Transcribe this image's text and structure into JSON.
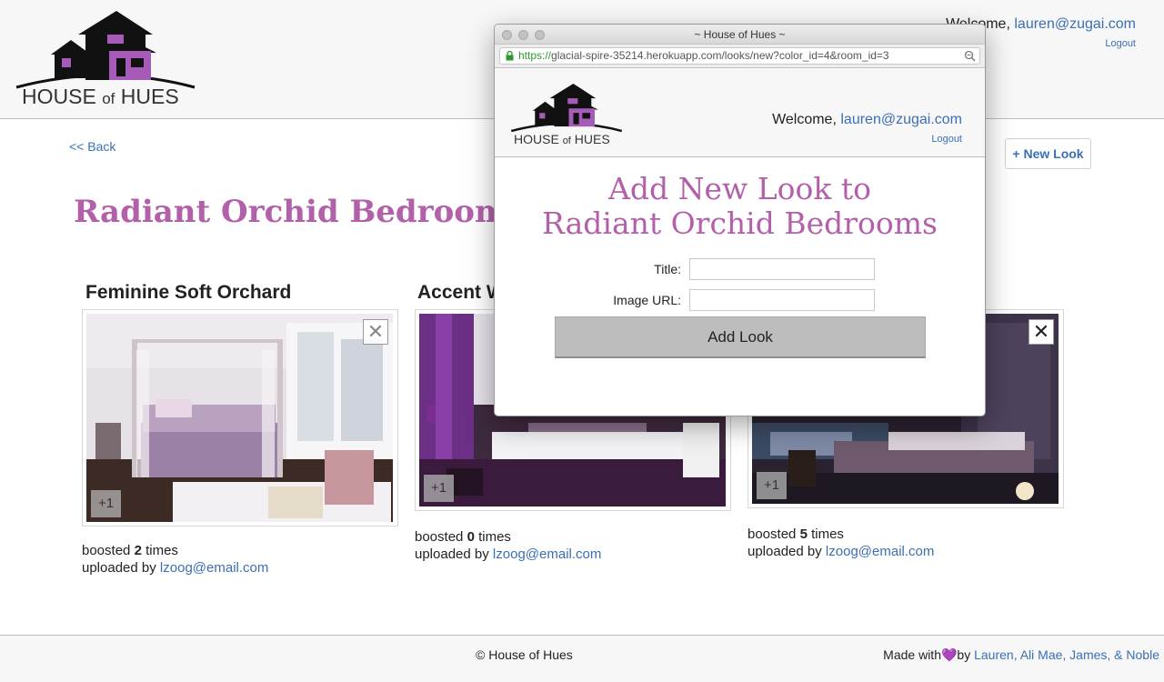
{
  "site": {
    "logo_main": "HOUSE",
    "logo_of": "of",
    "logo_end": "HUES",
    "welcome_prefix": "Welcome,",
    "user_email": "lauren@zugai.com",
    "logout_label": "Logout"
  },
  "page": {
    "back_label": "<< Back",
    "new_look_label": "+ New Look",
    "title": "Radiant Orchid Bedroom Lo"
  },
  "cards": [
    {
      "title": "Feminine Soft Orchard",
      "boost_label": "+1",
      "close_symbol": "✕",
      "boosted_prefix": "boosted",
      "boost_count": "2",
      "boosted_suffix": "times",
      "uploaded_prefix": "uploaded by",
      "uploader": "lzoog@email.com"
    },
    {
      "title": "Accent W",
      "boost_label": "+1",
      "boosted_prefix": "boosted",
      "boost_count": "0",
      "boosted_suffix": "times",
      "uploaded_prefix": "uploaded by",
      "uploader": "lzoog@email.com"
    },
    {
      "title": "",
      "boost_label": "+1",
      "close_symbol": "✕",
      "boosted_prefix": "boosted",
      "boost_count": "5",
      "boosted_suffix": "times",
      "uploaded_prefix": "uploaded by",
      "uploader": "lzoog@email.com"
    }
  ],
  "footer": {
    "copyright": "© House of Hues",
    "made_prefix": "Made with",
    "heart": "💜",
    "made_by": "by",
    "authors": "Lauren, Ali Mae, James, & Noble"
  },
  "popup": {
    "window_title": "~ House of Hues ~",
    "url_scheme": "https://",
    "url_rest": "glacial-spire-35214.herokuapp.com/looks/new?color_id=4&room_id=3",
    "welcome_prefix": "Welcome,",
    "user_email": "lauren@zugai.com",
    "logout_label": "Logout",
    "heading_line1": "Add New Look to",
    "heading_line2": "Radiant Orchid Bedrooms",
    "title_label": "Title:",
    "title_value": "",
    "image_url_label": "Image URL:",
    "image_url_value": "",
    "submit_label": "Add Look"
  },
  "colors": {
    "brand_purple": "#b360aa",
    "link_blue": "#3a6fb5",
    "logo_purple": "#a55bb8"
  }
}
